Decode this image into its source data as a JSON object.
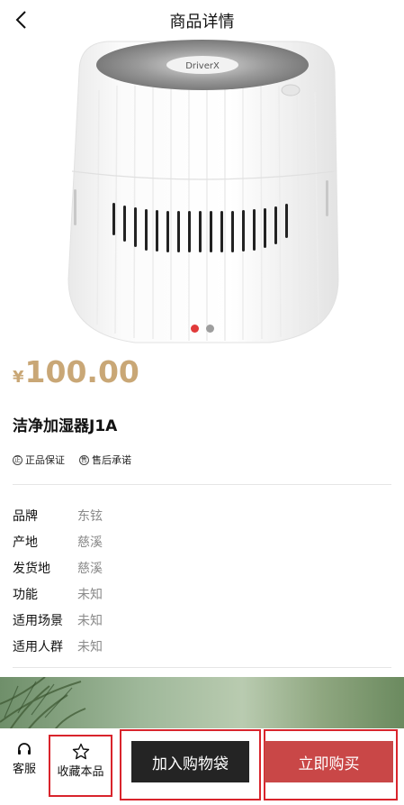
{
  "header": {
    "title": "商品详情",
    "back_icon": "chevron-left-icon"
  },
  "gallery": {
    "image_count": 2,
    "active_index": 0,
    "brand_mark": "DriverX"
  },
  "product": {
    "currency": "¥",
    "price": "100.00",
    "name": "洁净加湿器J1A",
    "price_color": "#c9a776"
  },
  "badges": [
    {
      "icon": "正",
      "label": "正品保证"
    },
    {
      "icon": "售",
      "label": "售后承诺"
    }
  ],
  "specs": [
    {
      "label": "品牌",
      "value": "东铉"
    },
    {
      "label": "产地",
      "value": "慈溪"
    },
    {
      "label": "发货地",
      "value": "慈溪"
    },
    {
      "label": "功能",
      "value": "未知"
    },
    {
      "label": "适用场景",
      "value": "未知"
    },
    {
      "label": "适用人群",
      "value": "未知"
    }
  ],
  "bottom_bar": {
    "service_label": "客服",
    "service_icon": "headset-icon",
    "favorite_label": "收藏本品",
    "favorite_icon": "star-icon",
    "add_to_cart_label": "加入购物袋",
    "buy_now_label": "立即购买",
    "cart_button_color": "#242424",
    "buy_button_color": "#c94747",
    "highlight_color": "#d9242c"
  }
}
